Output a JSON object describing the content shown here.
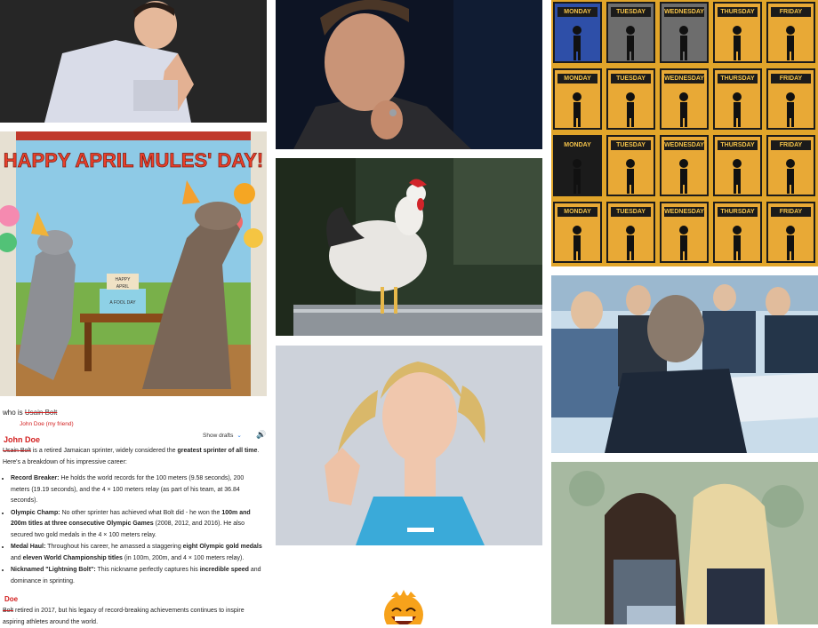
{
  "collage": {
    "tiles": [
      "man-praying-photo",
      "man-thinking-photo",
      "weekday-signs-grid",
      "happy-april-mules-day-illustration",
      "rooster-on-fence-photo",
      "business-meeting-photo",
      "girl-with-pigtails-photo",
      "two-girls-photo"
    ]
  },
  "mules_banner": {
    "text": "HAPPY APRIL MULES' DAY!"
  },
  "cake_text": {
    "line1": "HAPPY",
    "line2": "APRIL",
    "line3": "A FOOL DAY"
  },
  "weekdays": [
    "MONDAY",
    "TUESDAY",
    "WEDNESDAY",
    "THURSDAY",
    "FRIDAY"
  ],
  "doc": {
    "query_prefix": "who is ",
    "query_struck": "Usain Bolt",
    "query_note": "John Doe (my friend)",
    "show_drafts": "Show drafts",
    "speaker_icon": "🔊",
    "name_overlay": "John Doe",
    "intro_struck": "Usain Bolt",
    "intro_a": " is a retired Jamaican sprinter, widely considered the ",
    "intro_bold": "greatest sprinter of all time",
    "intro_b": ". Here's a breakdown of his impressive career:",
    "bullets": [
      {
        "title": "Record Breaker:",
        "text": " He holds the world records for the 100 meters (9.58 seconds), 200 meters (19.19 seconds), and the 4 × 100 meters relay (as part of his team, at 36.84 seconds)."
      },
      {
        "title": "Olympic Champ:",
        "text": " No other sprinter has achieved what Bolt did - he won the ",
        "bold2": "100m and 200m titles at three consecutive Olympic Games",
        "text2": " (2008, 2012, and 2016). He also secured two gold medals in the 4 × 100 meters relay."
      },
      {
        "title": "Medal Haul:",
        "text": " Throughout his career, he amassed a staggering ",
        "bold2": "eight Olympic gold medals",
        "text2": " and ",
        "bold3": "eleven World Championship titles",
        "text3": " (in 100m, 200m, and 4 × 100 meters relay)."
      },
      {
        "title": "Nicknamed \"Lightning Bolt\":",
        "text": " This nickname perfectly captures his ",
        "bold2": "incredible speed",
        "text2": " and dominance in sprinting."
      }
    ],
    "last_overlay": "Doe",
    "last_struck": "Bolt",
    "last_text": " retired in 2017, but his legacy of record-breaking achievements continues to inspire aspiring athletes around the world."
  }
}
